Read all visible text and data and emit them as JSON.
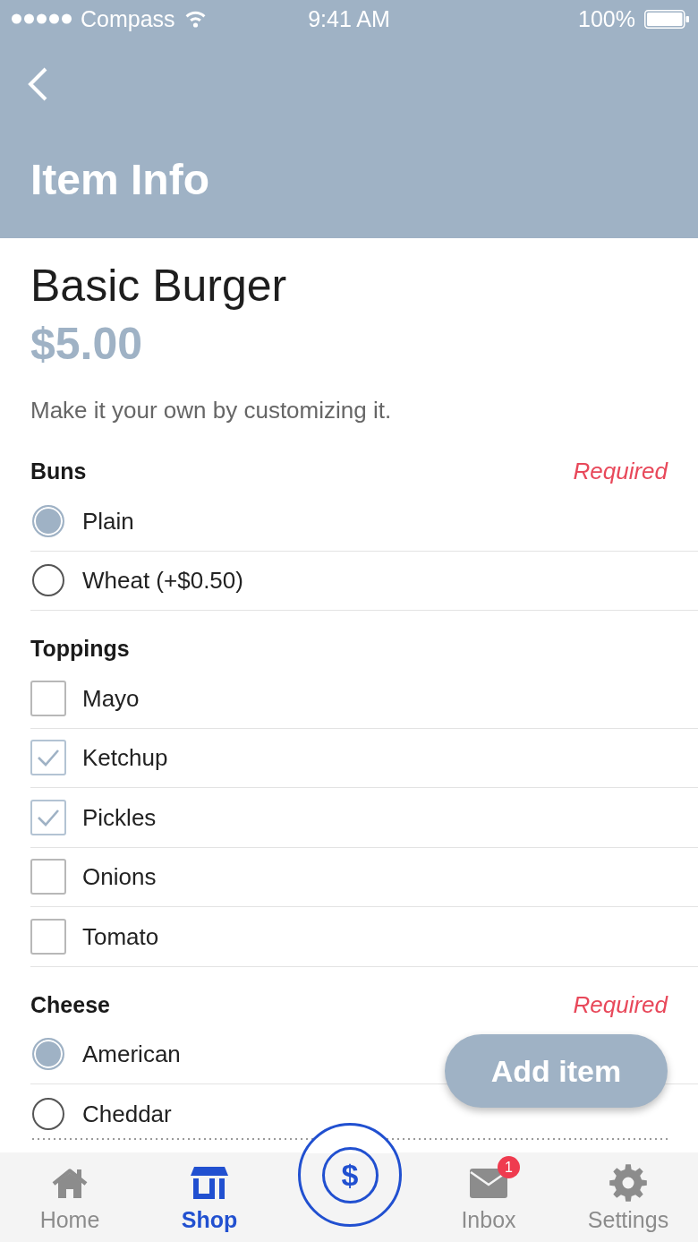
{
  "status_bar": {
    "carrier": "Compass",
    "time": "9:41 AM",
    "battery": "100%"
  },
  "header": {
    "title": "Item Info"
  },
  "item": {
    "name": "Basic Burger",
    "price": "$5.00",
    "description": "Make it your own by customizing it."
  },
  "option_groups": [
    {
      "title": "Buns",
      "kind": "radio",
      "required": "Required",
      "options": [
        {
          "label": "Plain",
          "selected": true
        },
        {
          "label": "Wheat (+$0.50)",
          "selected": false
        }
      ]
    },
    {
      "title": "Toppings",
      "kind": "checkbox",
      "options": [
        {
          "label": "Mayo",
          "checked": false
        },
        {
          "label": "Ketchup",
          "checked": true
        },
        {
          "label": "Pickles",
          "checked": true
        },
        {
          "label": "Onions",
          "checked": false
        },
        {
          "label": "Tomato",
          "checked": false
        }
      ]
    },
    {
      "title": "Cheese",
      "kind": "radio",
      "required": "Required",
      "options": [
        {
          "label": "American",
          "selected": true
        },
        {
          "label": "Cheddar",
          "selected": false
        }
      ]
    }
  ],
  "add_button": {
    "label": "Add item"
  },
  "tab_bar": {
    "tabs": [
      {
        "kind": "tab",
        "label": "Home",
        "selected": false
      },
      {
        "kind": "tab",
        "label": "Shop",
        "selected": true
      },
      {
        "kind": "action",
        "symbol": "$",
        "selected": false
      },
      {
        "kind": "tab",
        "label": "Inbox",
        "selected": false,
        "badge": "1"
      },
      {
        "kind": "tab",
        "label": "Settings",
        "selected": false
      }
    ]
  }
}
